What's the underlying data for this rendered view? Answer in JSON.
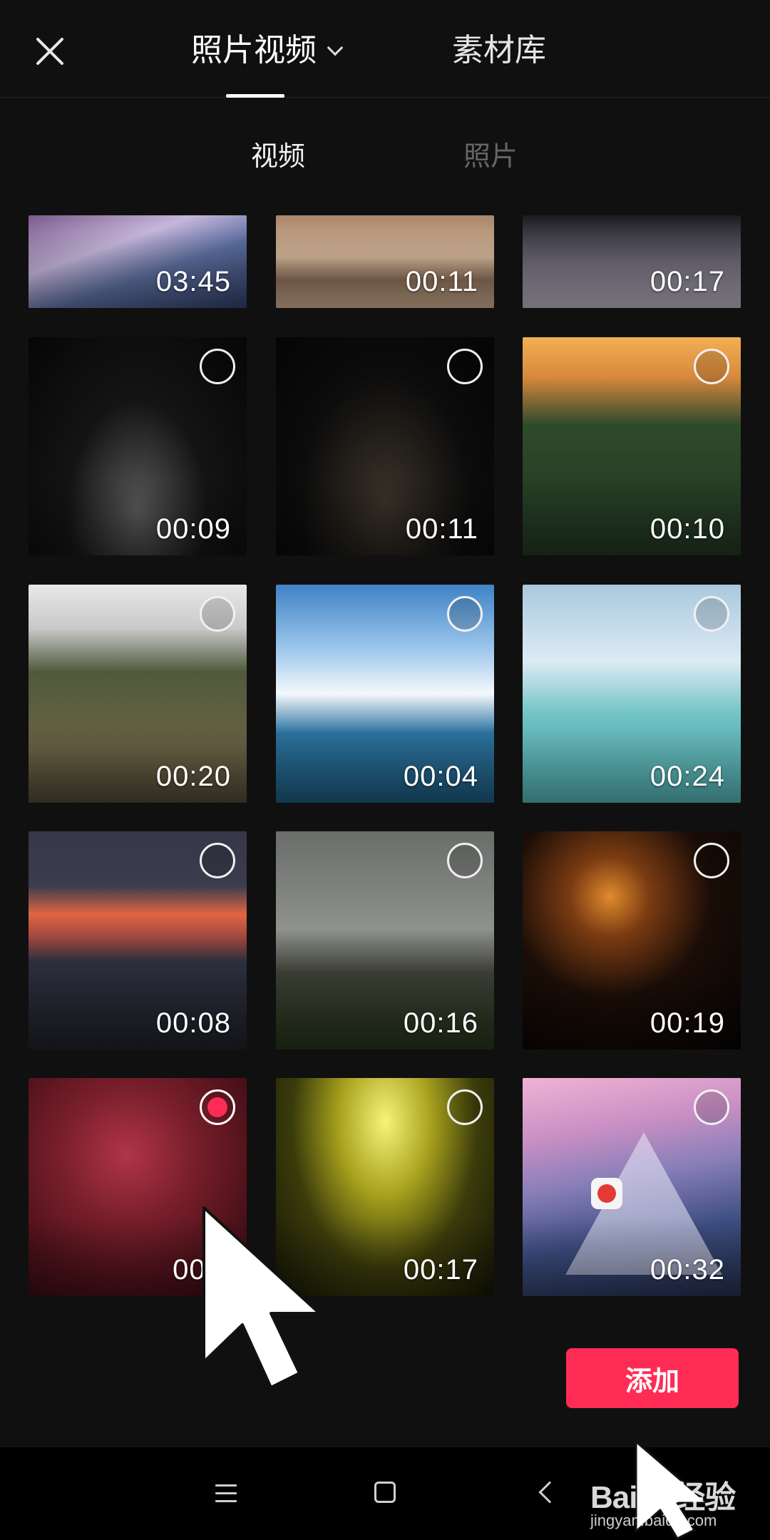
{
  "header": {
    "tab_photo_video": "照片视频",
    "tab_material": "素材库"
  },
  "sub_tabs": {
    "video": "视频",
    "photo": "照片"
  },
  "grid": [
    {
      "duration": "03:45",
      "scene": "mountain",
      "selectable": false,
      "selected": false
    },
    {
      "duration": "00:11",
      "scene": "beach",
      "selectable": false,
      "selected": false
    },
    {
      "duration": "00:17",
      "scene": "mist",
      "selectable": false,
      "selected": false
    },
    {
      "duration": "00:09",
      "scene": "night-road",
      "selectable": true,
      "selected": false
    },
    {
      "duration": "00:11",
      "scene": "night-drive",
      "selectable": true,
      "selected": false
    },
    {
      "duration": "00:10",
      "scene": "highway",
      "selectable": true,
      "selected": false
    },
    {
      "duration": "00:20",
      "scene": "road-valley",
      "selectable": true,
      "selected": false
    },
    {
      "duration": "00:04",
      "scene": "sea-clouds",
      "selectable": true,
      "selected": false
    },
    {
      "duration": "00:24",
      "scene": "lagoon",
      "selectable": true,
      "selected": false
    },
    {
      "duration": "00:08",
      "scene": "sunset-airport",
      "selectable": true,
      "selected": false
    },
    {
      "duration": "00:16",
      "scene": "plane",
      "selectable": true,
      "selected": false
    },
    {
      "duration": "00:19",
      "scene": "fireworks-gold",
      "selectable": true,
      "selected": false
    },
    {
      "duration": "00:1",
      "scene": "fireworks-red",
      "selectable": true,
      "selected": true
    },
    {
      "duration": "00:17",
      "scene": "concert",
      "selectable": true,
      "selected": false
    },
    {
      "duration": "00:32",
      "scene": "mountain2",
      "selectable": true,
      "selected": false
    }
  ],
  "add_button": "添加",
  "watermark": {
    "logo": "Baidu经验",
    "url": "jingyan.baidu.com"
  },
  "colors": {
    "accent": "#fe2c55",
    "background": "#101010"
  }
}
